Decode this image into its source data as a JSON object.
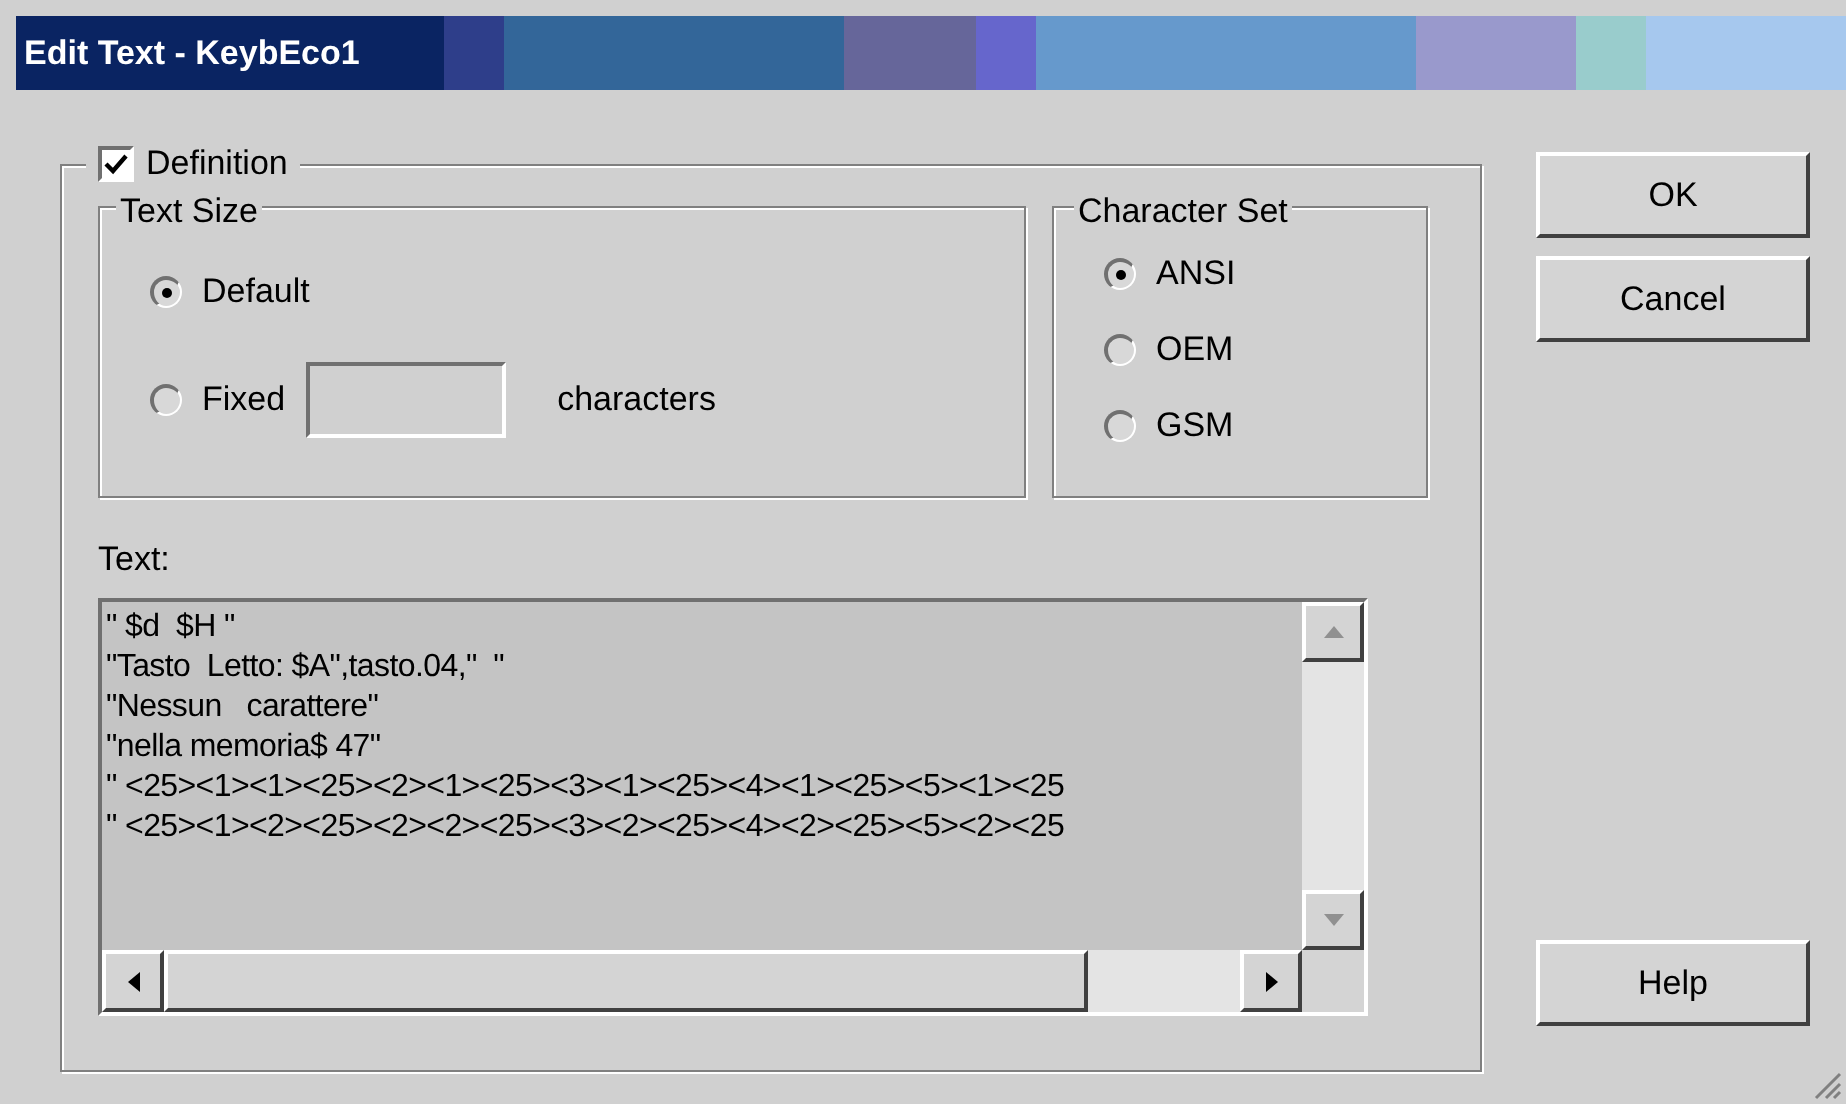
{
  "window": {
    "title": "Edit Text - KeybEco1"
  },
  "definition": {
    "label": "Definition",
    "checked": true
  },
  "text_size": {
    "title": "Text Size",
    "options": [
      {
        "label": "Default",
        "selected": true,
        "kind": "plain"
      },
      {
        "label": "Fixed",
        "selected": false,
        "kind": "with_field",
        "suffix": "characters"
      }
    ]
  },
  "character_set": {
    "title": "Character Set",
    "options": [
      {
        "label": "ANSI",
        "selected": true
      },
      {
        "label": "OEM",
        "selected": false
      },
      {
        "label": "GSM",
        "selected": false
      }
    ]
  },
  "text": {
    "label": "Text:",
    "lines": [
      "\" $d  $H \"",
      "\"Tasto  Letto: $A\",tasto.04,\"  \"",
      "\"Nessun   carattere\"",
      "\"nella memoria$ 47\"",
      "\" <25><1><1><25><2><1><25><3><1><25><4><1><25><5><1><25",
      "\" <25><1><2><25><2><2><25><3><2><25><4><2><25><5><2><25"
    ]
  },
  "buttons": [
    "OK",
    "Cancel"
  ],
  "help_button": "Help"
}
